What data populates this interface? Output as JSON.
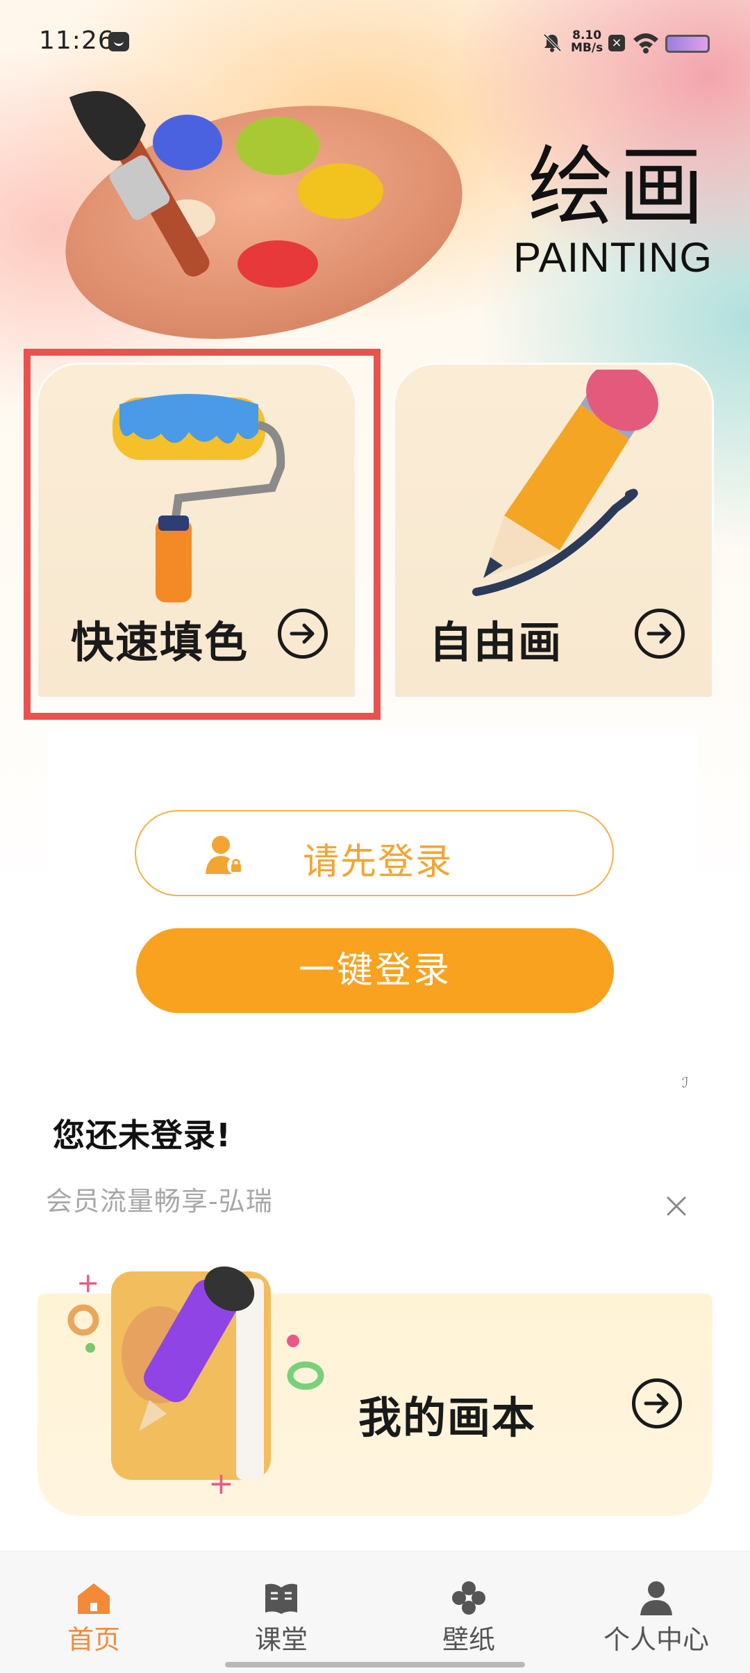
{
  "status_bar": {
    "time": "11:26",
    "net_speed_value": "8.10",
    "net_speed_unit": "MB/s"
  },
  "header": {
    "title_cn": "绘画",
    "title_en": "PAINTING"
  },
  "cards": {
    "quick_fill": "快速填色",
    "free_draw": "自由画"
  },
  "login": {
    "login_first_label": "请先登录",
    "one_click_label": "一键登录"
  },
  "notice": {
    "not_logged_in": "您还未登录!",
    "member_text": "会员流量畅享-弘瑞"
  },
  "album": {
    "label": "我的画本"
  },
  "bottom_nav": {
    "items": [
      {
        "label": "首页",
        "icon": "home-icon",
        "active": true
      },
      {
        "label": "课堂",
        "icon": "book-icon",
        "active": false
      },
      {
        "label": "壁纸",
        "icon": "clover-icon",
        "active": false
      },
      {
        "label": "个人中心",
        "icon": "person-icon",
        "active": false
      }
    ]
  },
  "colors": {
    "accent_orange": "#f8a21f",
    "nav_active": "#f28a3a",
    "highlight_red": "#e8524f"
  }
}
